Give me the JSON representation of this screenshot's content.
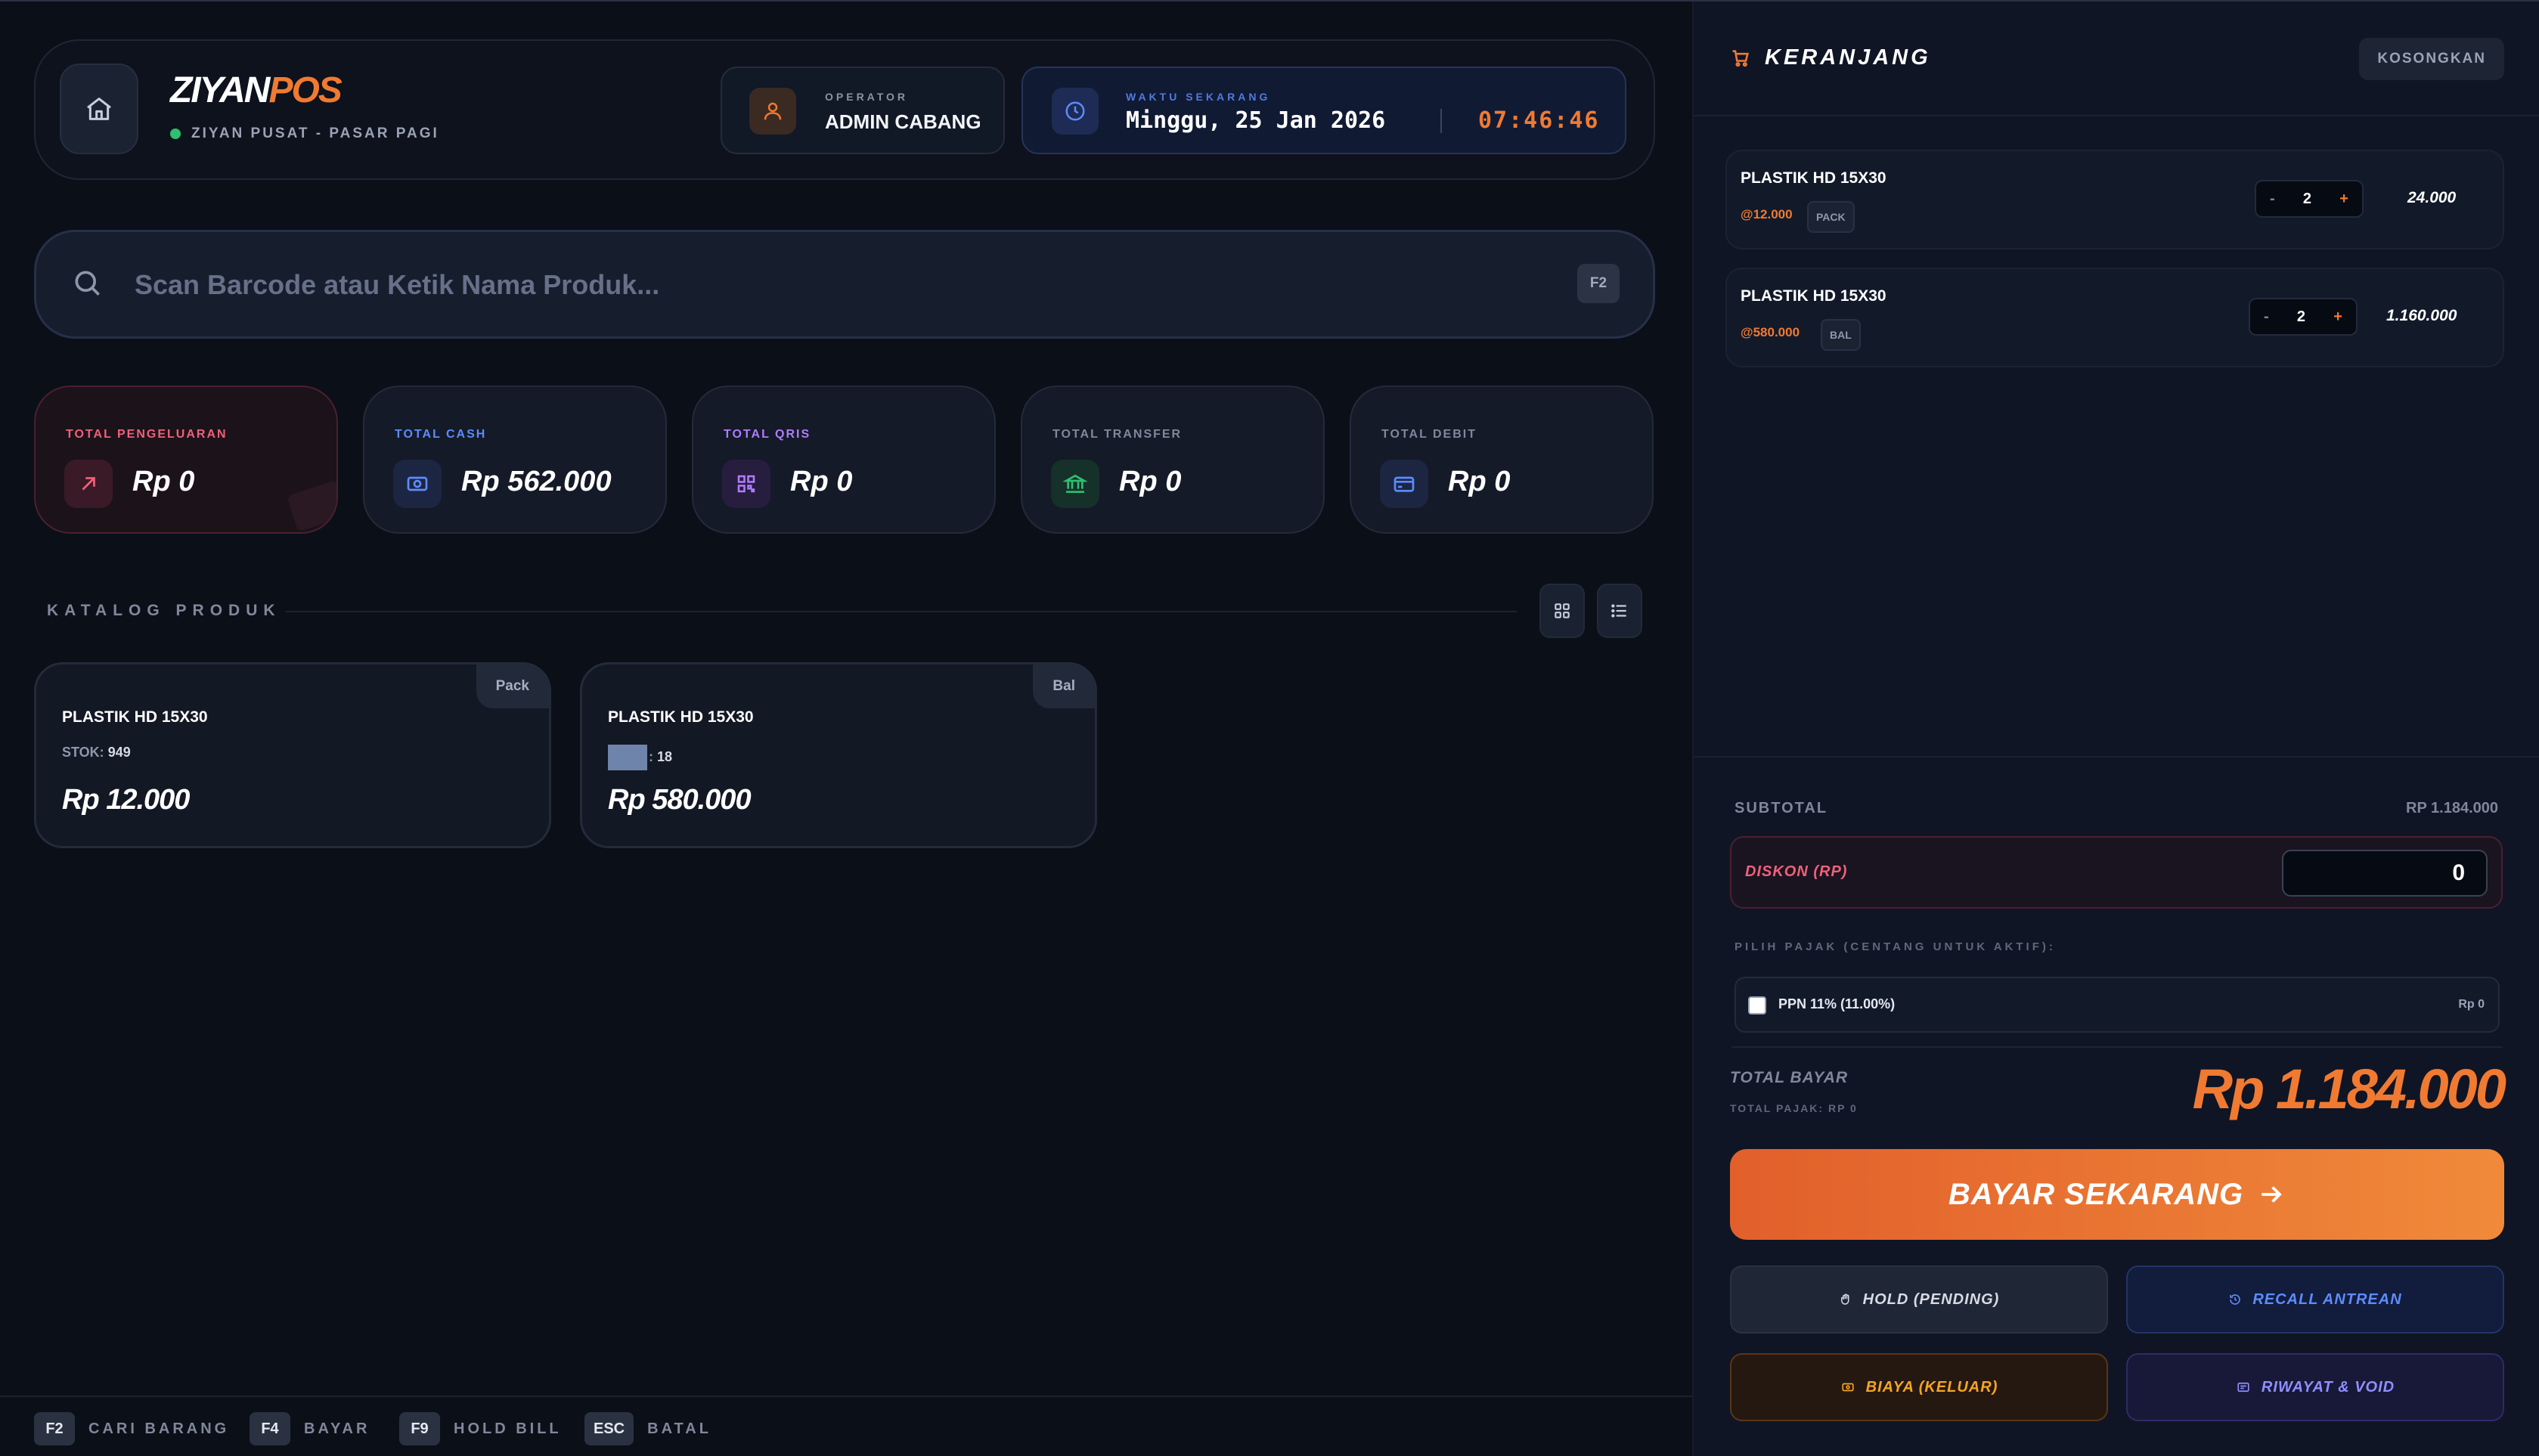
{
  "header": {
    "brand_main": "ZIYAN",
    "brand_accent": "POS",
    "branch": "ZIYAN PUSAT - PASAR PAGI",
    "operator_label": "OPERATOR",
    "operator_name": "ADMIN CABANG",
    "time_label": "WAKTU SEKARANG",
    "date": "Minggu, 25 Jan 2026",
    "clock": "07:46:46"
  },
  "search": {
    "placeholder": "Scan Barcode atau Ketik Nama Produk...",
    "shortcut": "F2"
  },
  "stats": [
    {
      "label": "TOTAL PENGELUARAN",
      "value": "Rp 0",
      "icon": "arrow-up-right-icon",
      "color": "#f0607a"
    },
    {
      "label": "TOTAL CASH",
      "value": "Rp 562.000",
      "icon": "cash-icon",
      "color": "#5b8cff"
    },
    {
      "label": "TOTAL QRIS",
      "value": "Rp 0",
      "icon": "qr-icon",
      "color": "#b07cff"
    },
    {
      "label": "TOTAL TRANSFER",
      "value": "Rp 0",
      "icon": "bank-icon",
      "color": "#2fbf71"
    },
    {
      "label": "TOTAL DEBIT",
      "value": "Rp 0",
      "icon": "card-icon",
      "color": "#5b8cff"
    }
  ],
  "catalog": {
    "title": "KATALOG PRODUK",
    "products": [
      {
        "name": "PLASTIK HD 15X30",
        "unit": "Pack",
        "stock_label": "STOK:",
        "stock": "949",
        "price": "Rp 12.000"
      },
      {
        "name": "PLASTIK HD 15X30",
        "unit": "Bal",
        "stock_label": ":",
        "stock": "18",
        "price": "Rp 580.000"
      }
    ]
  },
  "footer": {
    "shortcuts": [
      {
        "key": "F2",
        "label": "CARI BARANG"
      },
      {
        "key": "F4",
        "label": "BAYAR"
      },
      {
        "key": "F9",
        "label": "HOLD BILL"
      },
      {
        "key": "ESC",
        "label": "BATAL"
      }
    ]
  },
  "cart": {
    "title": "KERANJANG",
    "clear_label": "KOSONGKAN",
    "items": [
      {
        "name": "PLASTIK HD 15X30",
        "unit_price": "@12.000",
        "unit": "PACK",
        "qty": "2",
        "total": "24.000"
      },
      {
        "name": "PLASTIK HD 15X30",
        "unit_price": "@580.000",
        "unit": "BAL",
        "qty": "2",
        "total": "1.160.000"
      }
    ],
    "minus": "-",
    "plus": "+"
  },
  "summary": {
    "subtotal_label": "SUBTOTAL",
    "subtotal_value": "RP 1.184.000",
    "discount_label": "DISKON (RP)",
    "discount_value": "0",
    "tax_title": "PILIH PAJAK (CENTANG UNTUK AKTIF):",
    "tax_label": "PPN 11% (11.00%)",
    "tax_value": "Rp 0",
    "total_label": "TOTAL BAYAR",
    "total_tax": "TOTAL PAJAK: RP 0",
    "total_value": "Rp 1.184.000",
    "pay_label": "BAYAR SEKARANG",
    "hold_label": "HOLD (PENDING)",
    "recall_label": "RECALL ANTREAN",
    "biaya_label": "BIAYA (KELUAR)",
    "riwayat_label": "RIWAYAT & VOID"
  },
  "colors": {
    "accent": "#f07a32",
    "background": "#0b0f18",
    "panel": "#0f1524"
  }
}
